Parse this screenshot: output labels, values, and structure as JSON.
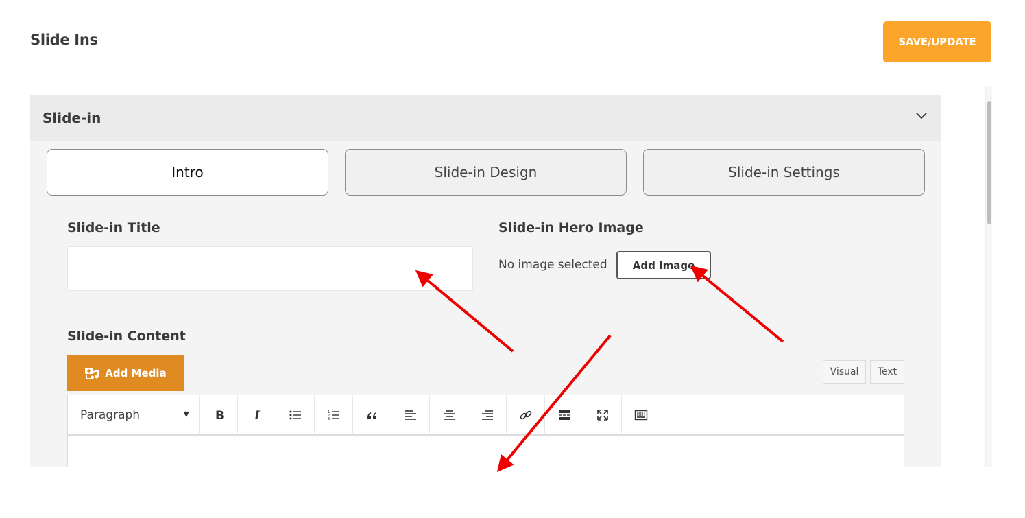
{
  "page": {
    "title": "Slide Ins",
    "save_label": "SAVE/UPDATE"
  },
  "panel": {
    "title": "Slide-in",
    "tabs": [
      {
        "label": "Intro",
        "active": true
      },
      {
        "label": "Slide-in Design",
        "active": false
      },
      {
        "label": "Slide-in Settings",
        "active": false
      }
    ]
  },
  "form": {
    "title_label": "Slide-in Title",
    "title_value": "",
    "hero_label": "Slide-in Hero Image",
    "no_image_text": "No image selected",
    "add_image_label": "Add Image",
    "content_label": "Slide-in Content",
    "add_media_label": "Add Media"
  },
  "editor": {
    "mode_tabs": [
      "Visual",
      "Text"
    ],
    "format_value": "Paragraph",
    "toolbar_icons": [
      "bold-icon",
      "italic-icon",
      "bulleted-list-icon",
      "numbered-list-icon",
      "blockquote-icon",
      "align-left-icon",
      "align-center-icon",
      "align-right-icon",
      "link-icon",
      "read-more-icon",
      "fullscreen-icon",
      "toolbar-toggle-icon"
    ]
  },
  "colors": {
    "accent": "#fba52a",
    "media_button": "#e08b22",
    "annotation_arrow": "#ee0000"
  }
}
